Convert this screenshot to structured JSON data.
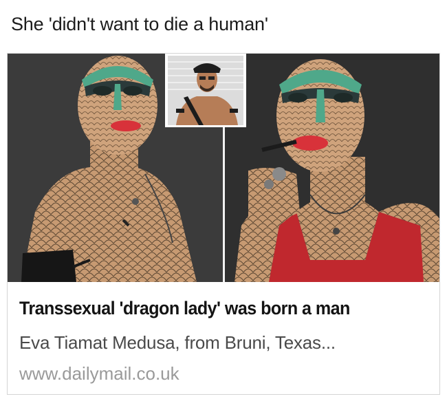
{
  "post": {
    "caption": "She 'didn't want to die a human'"
  },
  "link_card": {
    "title": "Transsexual 'dragon lady' was born a man",
    "description": "Eva Tiamat Medusa, from Bruni, Texas...",
    "domain": "www.dailymail.co.uk",
    "image": {
      "panels": [
        "left-portrait",
        "inset-photo",
        "right-portrait"
      ],
      "colors": {
        "background": "#3a3a3a",
        "skin": "#c79a72",
        "scale_lines": "#5a4632",
        "face_paint_green": "#4fa88a",
        "lips": "#d8323a",
        "tank_top": "#c0282e"
      }
    }
  }
}
